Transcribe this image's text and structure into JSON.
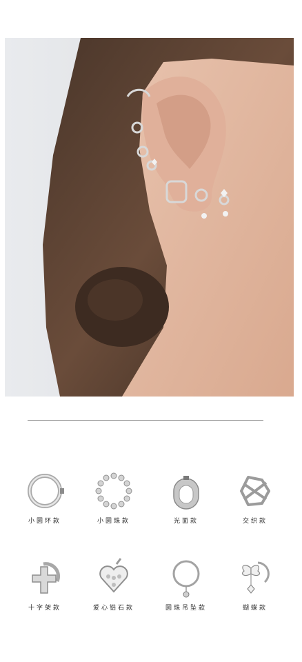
{
  "products": [
    {
      "label": "小圆环款",
      "icon": "small-hoop-icon"
    },
    {
      "label": "小圆珠款",
      "icon": "beaded-hoop-icon"
    },
    {
      "label": "光面款",
      "icon": "smooth-huggie-icon"
    },
    {
      "label": "交织款",
      "icon": "woven-cuff-icon"
    },
    {
      "label": "十字架款",
      "icon": "cross-huggie-icon"
    },
    {
      "label": "爱心锆石款",
      "icon": "heart-zircon-icon"
    },
    {
      "label": "圆珠吊坠款",
      "icon": "bead-pendant-hoop-icon"
    },
    {
      "label": "蝴蝶款",
      "icon": "butterfly-hoop-icon"
    }
  ]
}
